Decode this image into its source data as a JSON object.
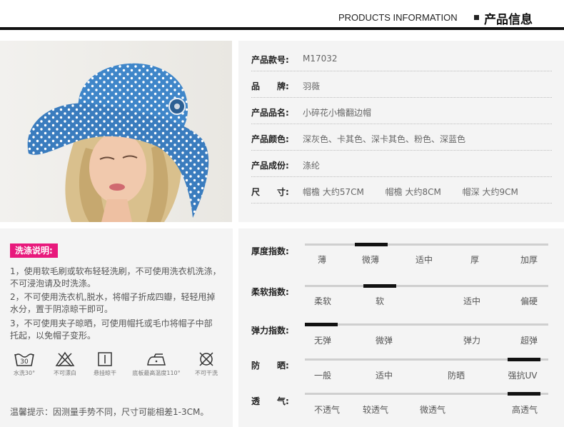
{
  "header": {
    "en": "PRODUCTS INFORMATION",
    "cn": "产品信息"
  },
  "photo": {
    "alt": "hat-model-photo"
  },
  "info": {
    "rows": [
      {
        "label": "产品款号:",
        "value": "M17032"
      },
      {
        "label": "品　　牌:",
        "value": "羽薇"
      },
      {
        "label": "产品品名:",
        "value": "小碎花小檐翻边帽"
      },
      {
        "label": "产品颜色:",
        "value": "深灰色、卡其色、深卡其色、粉色、深蓝色"
      },
      {
        "label": "产品成份:",
        "value": "涤纶"
      }
    ],
    "size_label": "尺　　寸:",
    "sizes": [
      "帽檐  大约57CM",
      "帽檐  大约8CM",
      "帽深  大约9CM"
    ]
  },
  "care": {
    "title": "洗涤说明:",
    "items": [
      "1，使用软毛刷或软布轻轻洗刷，不可使用洗衣机洗涤，　不可浸泡请及时洗涤。",
      "2，不可使用洗衣机,脱水，将帽子折成四瓣，轻轻甩掉　水分，置于阴凉晾干即可。",
      "3，不可使用夹子晾晒，可使用帽托或毛巾将帽子中部　托起，以免帽子变形。"
    ],
    "icons": [
      {
        "name": "wash-30-icon",
        "label": "水洗30°",
        "num": "30"
      },
      {
        "name": "no-bleach-icon",
        "label": "不可漂白"
      },
      {
        "name": "hang-dry-icon",
        "label": "悬挂晾干"
      },
      {
        "name": "iron-110-icon",
        "label": "底板最高温度110°"
      },
      {
        "name": "no-tumble-dry-icon",
        "label": "不可干洗"
      }
    ],
    "note": "温馨提示：因测量手势不同，尺寸可能相差1-3CM。"
  },
  "scales": [
    {
      "label": "厚度指数:",
      "options": [
        "薄",
        "微薄",
        "适中",
        "厚",
        "加厚"
      ],
      "selected": "微薄"
    },
    {
      "label": "柔软指数:",
      "options": [
        "柔软",
        "软",
        "适中",
        "偏硬"
      ],
      "selected": "软"
    },
    {
      "label": "弹力指数:",
      "options": [
        "无弹",
        "微弹",
        "弹力",
        "超弹"
      ],
      "selected": "无弹"
    },
    {
      "label": "防　　晒:",
      "options": [
        "一般",
        "适中",
        "防晒",
        "强抗UV"
      ],
      "selected": "强抗UV"
    },
    {
      "label": "透　　气:",
      "options": [
        "不透气",
        "较透气",
        "微透气",
        "高透气"
      ],
      "selected": "高透气"
    }
  ],
  "colors": {
    "accent": "#e8197c",
    "hat": "#3f86c9",
    "panel": "#f4f4f4"
  }
}
